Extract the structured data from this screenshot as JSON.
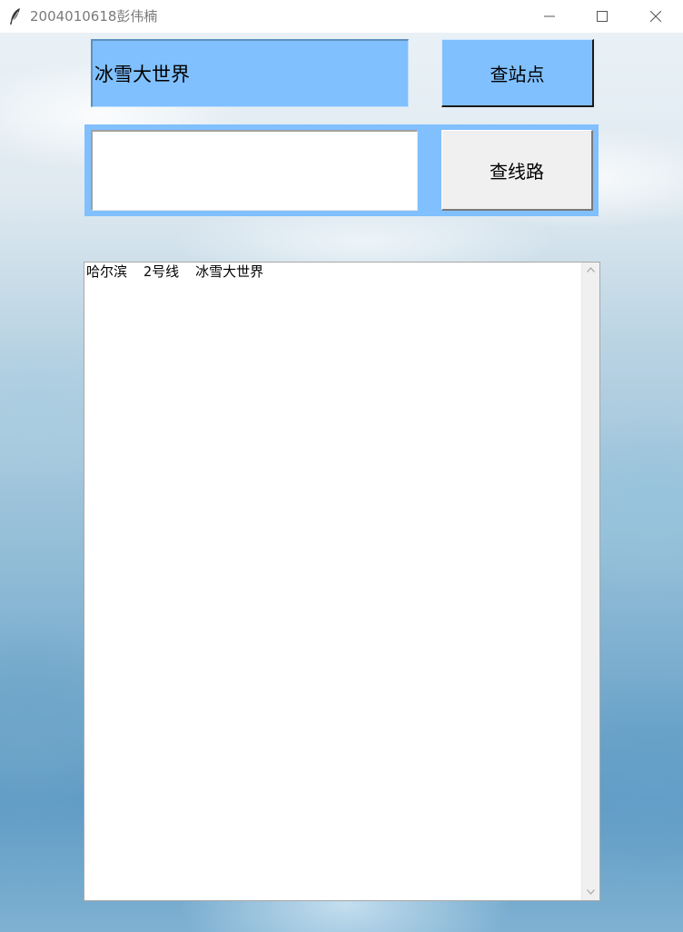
{
  "window": {
    "title": "2004010618彭伟楠",
    "icon": "feather-icon"
  },
  "station_search": {
    "input_value": "冰雪大世界",
    "button_label": "查站点",
    "accent_color": "#80c0ff"
  },
  "line_search": {
    "input_value": "",
    "button_label": "查线路"
  },
  "results": {
    "text": "哈尔滨  2号线  冰雪大世界"
  },
  "colors": {
    "accent": "#80c0ff",
    "button_face": "#f0f0f0"
  }
}
